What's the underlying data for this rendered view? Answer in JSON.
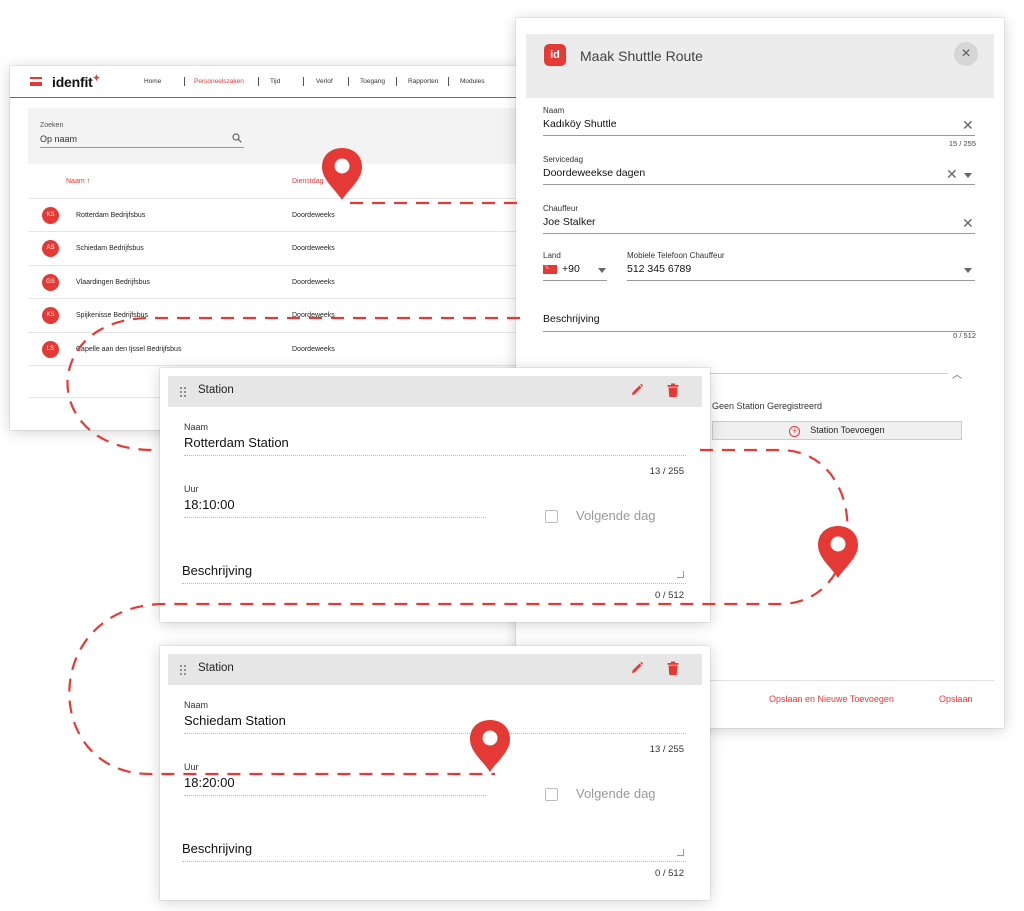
{
  "list_window": {
    "brand": "idenfit",
    "nav": [
      "Home",
      "Personeelszaken",
      "Tijd",
      "Verlof",
      "Toegang",
      "Rapporten",
      "Modules"
    ],
    "search_label": "Zoeken",
    "search_value": "Op naam",
    "columns": [
      "Naam",
      "Dienstdag"
    ],
    "rows": [
      {
        "initials": "KS",
        "name": "Rotterdam Bedrijfsbus",
        "day": "Doordeweeks"
      },
      {
        "initials": "AS",
        "name": "Schiedam Bedrijfsbus",
        "day": "Doordeweeks"
      },
      {
        "initials": "GS",
        "name": "Vlaardingen Bedrijfsbus",
        "day": "Doordeweeks"
      },
      {
        "initials": "KS",
        "name": "Spijkenisse Bedrijfsbus",
        "day": "Doordeweeks"
      },
      {
        "initials": "LS",
        "name": "Capelle aan den Ijssel Bedrijfsbus",
        "day": "Doordeweeks"
      }
    ],
    "sort_arrow": "↑"
  },
  "modal": {
    "logo": "id",
    "title": "Maak Shuttle Route",
    "name_label": "Naam",
    "name_value": "Kadıköy Shuttle",
    "name_counter": "15 / 255",
    "serviceday_label": "Servicedag",
    "serviceday_value": "Doordeweekse dagen",
    "driver_label": "Chauffeur",
    "driver_value": "Joe Stalker",
    "country_label": "Land",
    "country_code": "+90",
    "phone_label": "Mobiele Telefoon Chauffeur",
    "phone_value": "512 345 6789",
    "description_value": "Beschrijving",
    "description_counter": "0 / 512",
    "no_station": "Geen Station Geregistreerd",
    "add_station": "Station Toevoegen",
    "save_new": "Opslaan en Nieuwe Toevoegen",
    "save": "Opslaan"
  },
  "stations": [
    {
      "title": "Station",
      "name_label": "Naam",
      "name_value": "Rotterdam Station",
      "name_counter": "13 / 255",
      "time_label": "Uur",
      "time_value": "18:10:00",
      "nextday_label": "Volgende dag",
      "description_value": "Beschrijving",
      "description_counter": "0 / 512"
    },
    {
      "title": "Station",
      "name_label": "Naam",
      "name_value": "Schiedam Station",
      "name_counter": "13 / 255",
      "time_label": "Uur",
      "time_value": "18:20:00",
      "nextday_label": "Volgende dag",
      "description_value": "Beschrijving",
      "description_counter": "0 / 512"
    }
  ],
  "colors": {
    "accent": "#e53935",
    "route": "#e53935"
  },
  "icons": [
    "hamburger-icon",
    "search-icon",
    "close-icon",
    "chevron-down-icon",
    "chevron-up-icon",
    "drag-handle-icon",
    "pencil-icon",
    "trash-icon",
    "plus-circle-icon",
    "map-pin-icon",
    "flag-icon"
  ]
}
